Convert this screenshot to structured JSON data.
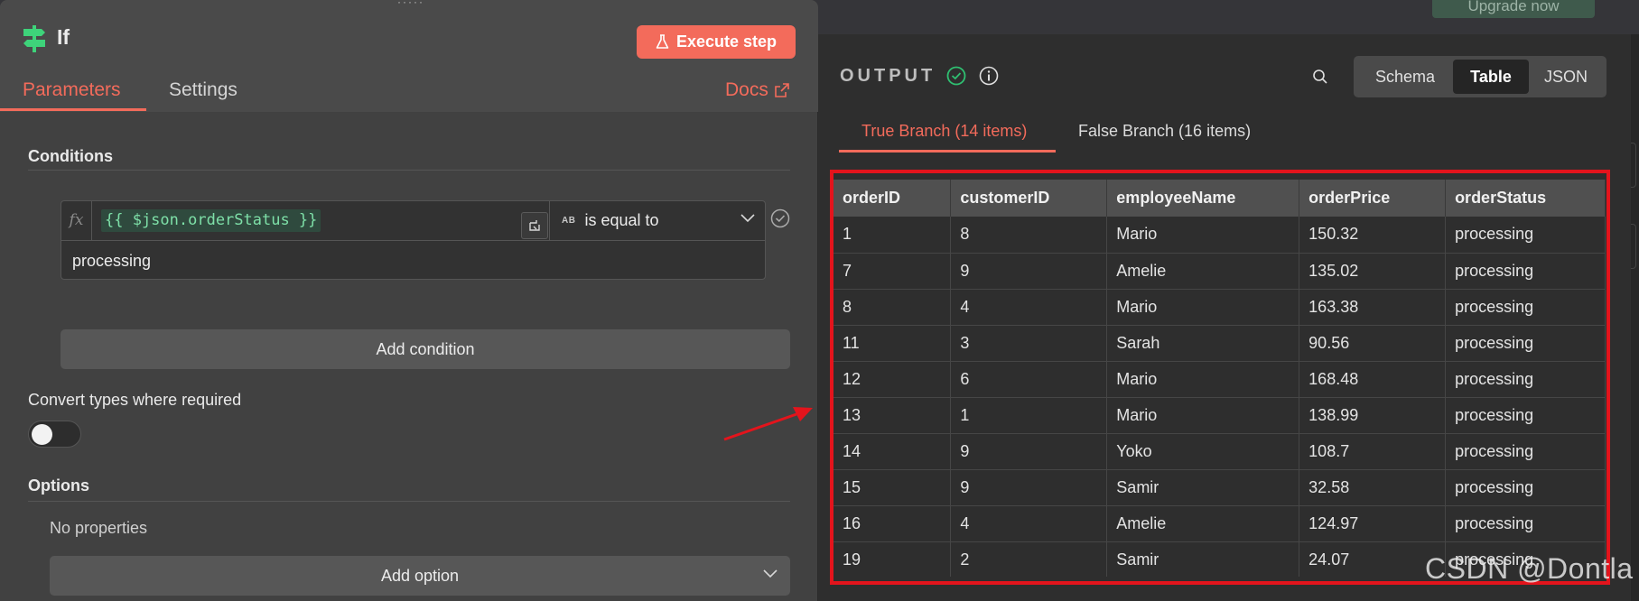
{
  "top_bar": {
    "upgrade_label": "Upgrade now"
  },
  "node": {
    "title": "If",
    "execute_label": "Execute step"
  },
  "tabs": {
    "parameters": "Parameters",
    "settings": "Settings",
    "docs": "Docs"
  },
  "conditions": {
    "heading": "Conditions",
    "expression": "{{ $json.orderStatus }}",
    "operator_type": "AB",
    "operator": "is equal to",
    "value": "processing",
    "add_condition_label": "Add condition"
  },
  "convert_types": {
    "label": "Convert types where required",
    "enabled": false
  },
  "options": {
    "heading": "Options",
    "empty_text": "No properties",
    "add_option_label": "Add option"
  },
  "output": {
    "label": "OUTPUT",
    "views": [
      "Schema",
      "Table",
      "JSON"
    ],
    "selected_view": "Table",
    "branches": [
      "True Branch (14 items)",
      "False Branch (16 items)"
    ],
    "active_branch": "True Branch (14 items)",
    "columns": [
      "orderID",
      "customerID",
      "employeeName",
      "orderPrice",
      "orderStatus"
    ],
    "rows": [
      [
        "1",
        "8",
        "Mario",
        "150.32",
        "processing"
      ],
      [
        "7",
        "9",
        "Amelie",
        "135.02",
        "processing"
      ],
      [
        "8",
        "4",
        "Mario",
        "163.38",
        "processing"
      ],
      [
        "11",
        "3",
        "Sarah",
        "90.56",
        "processing"
      ],
      [
        "12",
        "6",
        "Mario",
        "168.48",
        "processing"
      ],
      [
        "13",
        "1",
        "Mario",
        "138.99",
        "processing"
      ],
      [
        "14",
        "9",
        "Yoko",
        "108.7",
        "processing"
      ],
      [
        "15",
        "9",
        "Samir",
        "32.58",
        "processing"
      ],
      [
        "16",
        "4",
        "Amelie",
        "124.97",
        "processing"
      ],
      [
        "19",
        "2",
        "Samir",
        "24.07",
        "processing"
      ]
    ]
  },
  "watermark": "CSDN @Dontla",
  "colors": {
    "accent": "#f36b5b",
    "success": "#2fbf71",
    "highlight": "#e3141c",
    "expression_text": "#7ee0a8"
  }
}
